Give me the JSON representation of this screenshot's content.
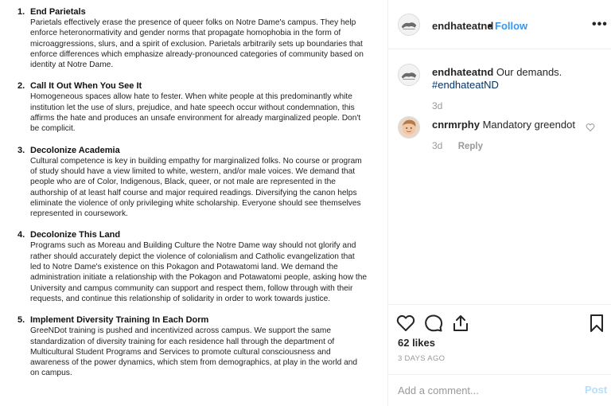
{
  "post_image": {
    "demands": [
      {
        "number": "1.",
        "title": "End Parietals",
        "body": "Parietals effectively erase the presence of queer folks on Notre Dame's campus. They help enforce heteronormativity and gender norms that propagate homophobia in the form of microaggressions, slurs, and a spirit of exclusion. Parietals arbitrarily sets up boundaries that enforce differences which emphasize already-pronounced categories of community based on identity at Notre Dame."
      },
      {
        "number": "2.",
        "title": "Call It Out When You See It",
        "body": "Homogeneous spaces allow hate to fester. When white people at this predominantly white institution let the use of slurs, prejudice, and hate speech occur without condemnation, this affirms the hate and produces an unsafe environment for already marginalized people. Don't be complicit."
      },
      {
        "number": "3.",
        "title": "Decolonize Academia",
        "body": "Cultural competence is key in building empathy for marginalized folks. No course or program of study should have a view limited to white, western, and/or male voices. We demand that people who are of Color, Indigenous, Black, queer, or not male are represented in the authorship of at least half course and major required readings. Diversifying the canon helps eliminate the violence of only privileging white scholarship. Everyone should see themselves represented in coursework."
      },
      {
        "number": "4.",
        "title": "Decolonize This Land",
        "body": "Programs such as Moreau and Building Culture the Notre Dame way should not glorify and rather should accurately depict the violence of colonialism and Catholic evangelization that led to Notre Dame's existence on this Pokagon and Potawatomi land. We demand the administration initiate a relationship with the Pokagon and Potawatomi people, asking how the University and campus community can support and respect them, follow through with their requests, and continue this relationship of solidarity in order to work towards justice."
      },
      {
        "number": "5.",
        "title": "Implement Diversity Training In Each Dorm",
        "body": "GreeNDot training is pushed and incentivized across campus. We support the same standardization of diversity training for each residence hall through the department of Multicultural Student Programs and Services to promote cultural consciousness and awareness of the power dynamics, which stem from demographics, at play in the world and on campus."
      }
    ]
  },
  "header": {
    "username": "endhateatnd",
    "separator": "•",
    "follow_label": "Follow",
    "more_icon": "more-options-icon"
  },
  "comments": [
    {
      "username": "endhateatnd",
      "text": "Our demands.",
      "hashtag": "#endhateatND",
      "age": "3d"
    },
    {
      "username": "cnrmrphy",
      "text": "Mandatory greendot",
      "age": "3d",
      "reply_label": "Reply"
    }
  ],
  "actions": {
    "likes": "62 likes",
    "time": "3 DAYS AGO"
  },
  "add_comment": {
    "placeholder": "Add a comment...",
    "post_label": "Post"
  },
  "colors": {
    "accent": "#3897f0",
    "post_disabled": "#b2dffc",
    "hashtag": "#003569",
    "muted": "#999999",
    "border": "#efefef"
  }
}
